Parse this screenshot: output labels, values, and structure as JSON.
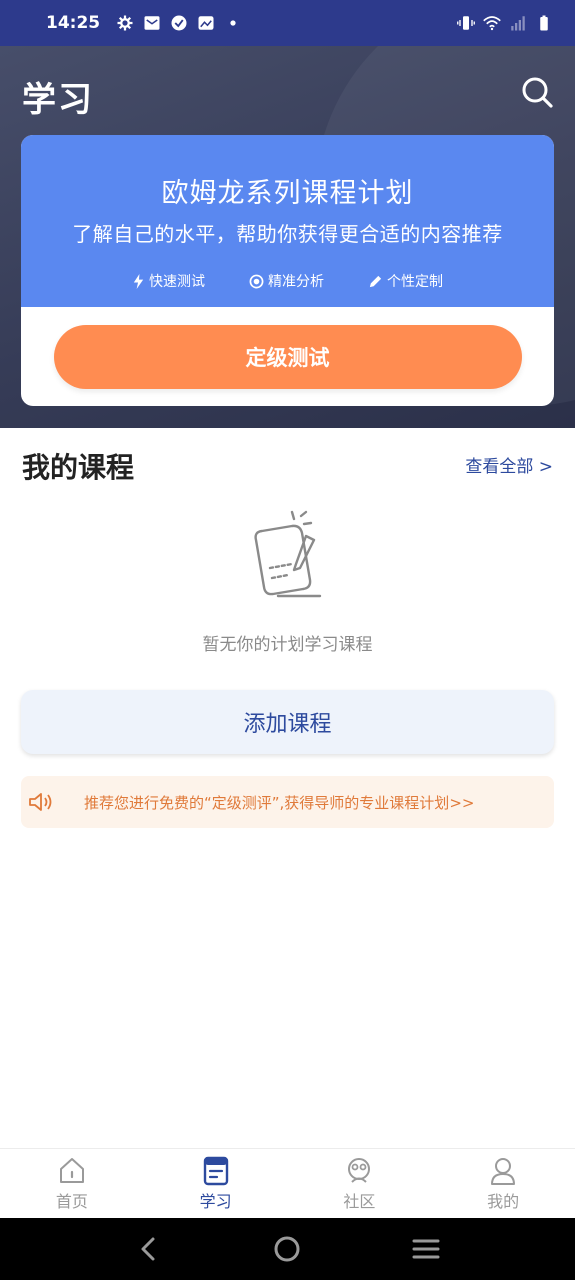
{
  "status_bar": {
    "time": "14:25"
  },
  "header": {
    "title": "学习"
  },
  "placement_card": {
    "title": "欧姆龙系列课程计划",
    "subtitle": "了解自己的水平，帮助你获得更合适的内容推荐",
    "features": [
      {
        "label": "快速测试",
        "icon": "lightning-icon"
      },
      {
        "label": "精准分析",
        "icon": "target-icon"
      },
      {
        "label": "个性定制",
        "icon": "pencil-icon"
      }
    ],
    "button_label": "定级测试"
  },
  "my_courses": {
    "title": "我的课程",
    "view_all": "查看全部 >",
    "empty_text": "暂无你的计划学习课程",
    "add_button": "添加课程"
  },
  "notice": {
    "text": "推荐您进行免费的“定级测评”,获得导师的专业课程计划>>"
  },
  "bottom_nav": {
    "items": [
      {
        "label": "首页",
        "icon": "home-icon"
      },
      {
        "label": "学习",
        "icon": "study-icon"
      },
      {
        "label": "社区",
        "icon": "community-icon"
      },
      {
        "label": "我的",
        "icon": "profile-icon"
      }
    ],
    "active_index": 1
  },
  "colors": {
    "status_bar": "#2d3a8c",
    "card_blue": "#5a88f0",
    "orange_button": "#ff8c51",
    "accent_blue": "#2d4a9e",
    "notice_text": "#e07a3a"
  }
}
